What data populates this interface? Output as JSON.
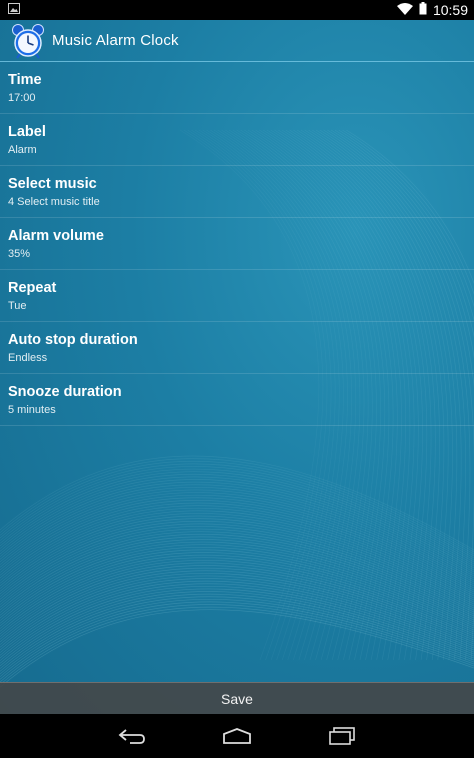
{
  "status_bar": {
    "time": "10:59"
  },
  "app": {
    "title": "Music Alarm Clock"
  },
  "preferences": [
    {
      "title": "Time",
      "summary": "17:00"
    },
    {
      "title": "Label",
      "summary": "Alarm"
    },
    {
      "title": "Select music",
      "summary": "4 Select music title"
    },
    {
      "title": "Alarm volume",
      "summary": "35%"
    },
    {
      "title": "Repeat",
      "summary": "Tue"
    },
    {
      "title": "Auto stop duration",
      "summary": "Endless"
    },
    {
      "title": "Snooze duration",
      "summary": "5 minutes"
    }
  ],
  "save_label": "Save",
  "colors": {
    "background": "#1c7ea4",
    "divider": "#78c8e6",
    "save_bar": "#464646"
  },
  "icons": [
    "image-icon",
    "wifi-icon",
    "battery-icon",
    "alarm-clock-icon",
    "back-icon",
    "home-icon",
    "recent-apps-icon"
  ]
}
